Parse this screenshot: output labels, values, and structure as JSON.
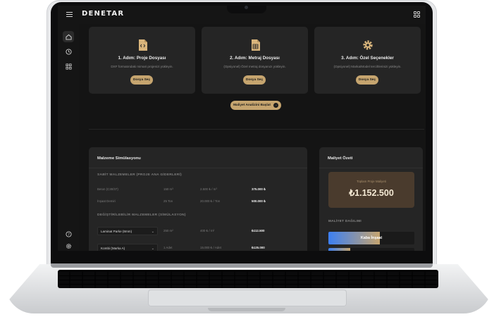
{
  "app": {
    "logo": "DENETAR"
  },
  "steps": [
    {
      "title": "1. Adım: Proje Dosyası",
      "desc": "DXF formatındaki mimari projenizi yükleyin.",
      "button": "Dosya Seç",
      "icon": "file-code-icon"
    },
    {
      "title": "2. Adım: Metraj Dosyası",
      "desc": "(Opsiyonel) Özel metraj dosyanızı yükleyin.",
      "button": "Dosya Seç",
      "icon": "spreadsheet-icon"
    },
    {
      "title": "3. Adım: Özel Seçenekler",
      "desc": "(Opsiyonel) Marka/Model tercihlerinizi yükleyin.",
      "button": "Dosya Seç",
      "icon": "gear-icon"
    }
  ],
  "analyze_button": "Maliyet Analizini Başlat",
  "simulation": {
    "title": "Malzeme Simülasyonu",
    "fixed_section": "SABİT MALZEMELER (PROJE ANA GİDERLERİ)",
    "fixed_rows": [
      {
        "name": "Beton (C30/37)",
        "qty": "150 m³",
        "price": "2.500 ₺ / m³",
        "total": "375.000 ₺"
      },
      {
        "name": "İnşaat Demiri",
        "qty": "25 Ton",
        "price": "20.000 ₺ / Ton",
        "total": "500.000 ₺"
      }
    ],
    "variable_section": "DEĞİŞTİRİLEBİLİR MALZEMELER (SİMÜLASYON)",
    "variable_rows": [
      {
        "name": "Laminat Parke (8mm)",
        "qty": "250 m²",
        "price": "400 ₺ / m²",
        "total": "₺112.500"
      },
      {
        "name": "Kombi (Marka A)",
        "qty": "1 Adet",
        "price": "15.000 ₺ / Adet",
        "total": "₺125.000"
      }
    ]
  },
  "summary": {
    "title": "Maliyet Özeti",
    "total_label": "Toplam Proje Maliyeti",
    "total_value": "₺1.152.500",
    "distribution_title": "MALİYET DAĞILIMI",
    "bars": [
      {
        "label": "Kaba İnşaat",
        "share": 0.6
      },
      {
        "label": "",
        "share": 0.25
      }
    ]
  }
}
